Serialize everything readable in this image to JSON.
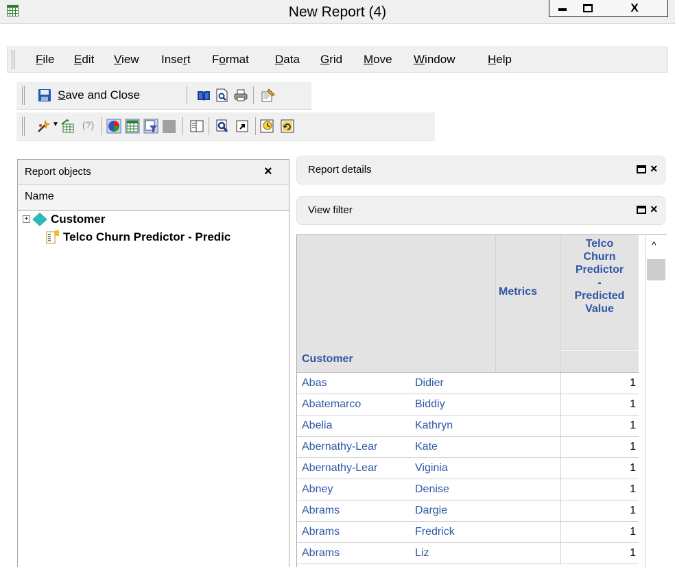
{
  "window": {
    "title": "New Report (4)",
    "min_glyph": "▬",
    "max_glyph": "◻",
    "close_glyph": "X"
  },
  "menu": {
    "items": [
      {
        "key": "F",
        "rest": "ile"
      },
      {
        "key": "E",
        "rest": "dit"
      },
      {
        "key": "V",
        "rest": "iew"
      },
      {
        "pre": "Inse",
        "key": "r",
        "rest": "t"
      },
      {
        "pre": "F",
        "key": "o",
        "rest": "rmat"
      },
      {
        "key": "D",
        "rest": "ata"
      },
      {
        "key": "G",
        "rest": "rid"
      },
      {
        "key": "M",
        "rest": "ove"
      },
      {
        "key": "W",
        "rest": "indow"
      },
      {
        "key": "H",
        "rest": "elp"
      }
    ]
  },
  "toolbar": {
    "save_key": "S",
    "save_rest": "ave and Close"
  },
  "report_objects": {
    "title": "Report objects",
    "close": "×",
    "column": "Name",
    "items": [
      {
        "label": "Customer",
        "expander": "+"
      },
      {
        "label": "Telco Churn Predictor - Predic"
      }
    ]
  },
  "report_details": {
    "title": "Report details",
    "close": "×"
  },
  "view_filter": {
    "title": "View filter",
    "close": "×"
  },
  "grid": {
    "metrics_header": "Metrics",
    "metric_header": [
      "Telco",
      "Churn",
      "Predictor",
      "-",
      "Predicted",
      "Value"
    ],
    "row_header": "Customer",
    "rows": [
      {
        "last": "Abas",
        "first": "Didier",
        "value": "1"
      },
      {
        "last": "Abatemarco",
        "first": "Biddiy",
        "value": "1"
      },
      {
        "last": "Abelia",
        "first": "Kathryn",
        "value": "1"
      },
      {
        "last": "Abernathy-Lear",
        "first": "Kate",
        "value": "1"
      },
      {
        "last": "Abernathy-Lear",
        "first": "Viginia",
        "value": "1"
      },
      {
        "last": "Abney",
        "first": "Denise",
        "value": "1"
      },
      {
        "last": "Abrams",
        "first": "Dargie",
        "value": "1"
      },
      {
        "last": "Abrams",
        "first": "Fredrick",
        "value": "1"
      },
      {
        "last": "Abrams",
        "first": "Liz",
        "value": "1"
      }
    ]
  },
  "scrollbar": {
    "up_glyph": "^"
  },
  "colors": {
    "header_text": "#2f56a6",
    "header_bg": "#e3e3e3",
    "chrome": "#f0f0f0"
  }
}
